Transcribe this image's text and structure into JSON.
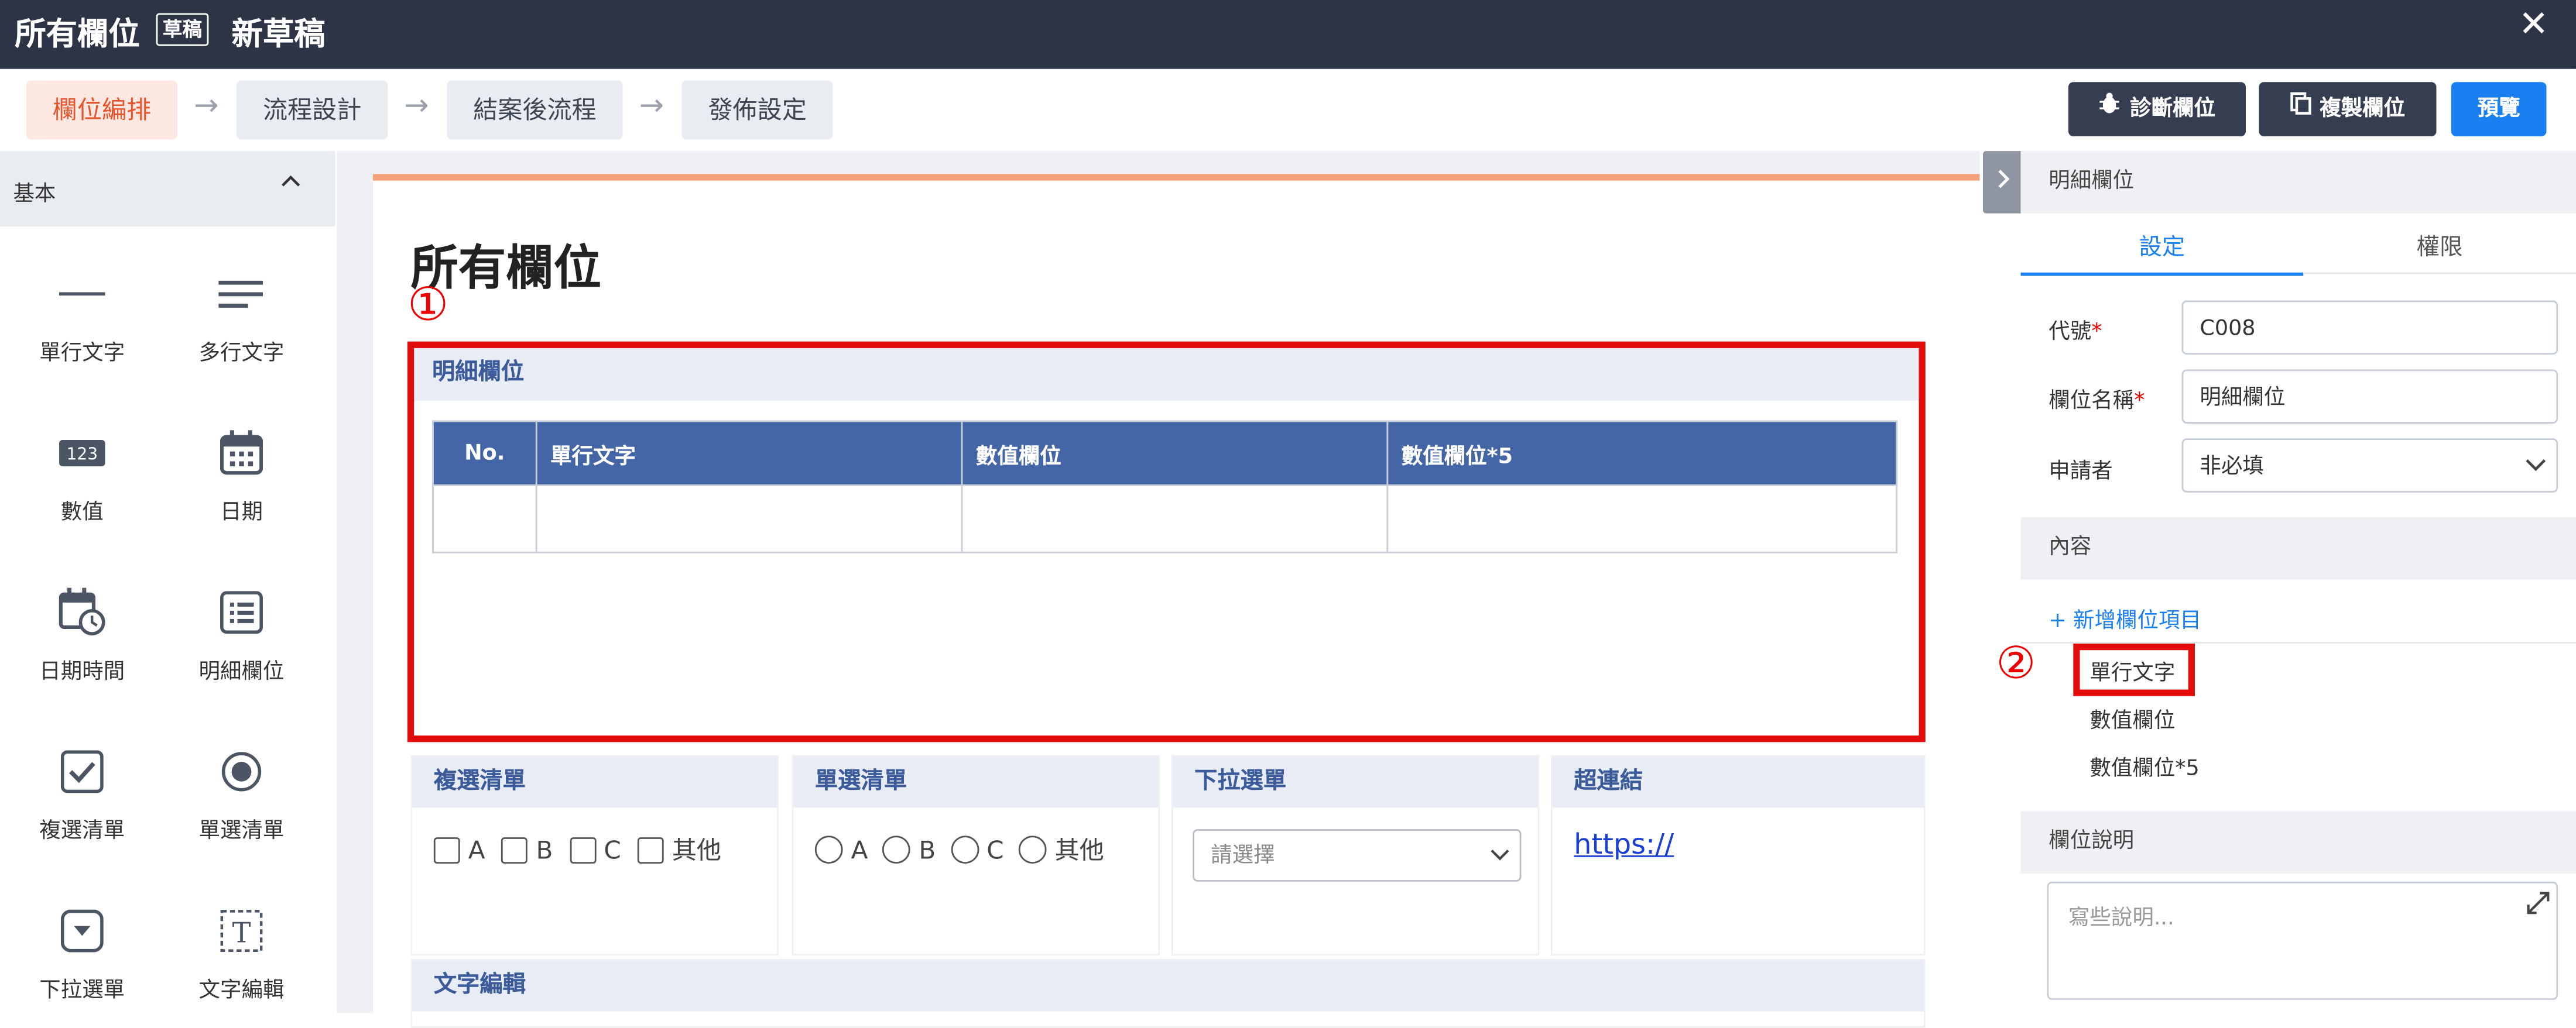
{
  "titlebar": {
    "title": "所有欄位",
    "badge": "草稿",
    "doc_name": "新草稿",
    "close": "✕"
  },
  "steps": [
    {
      "label": "欄位編排",
      "active": true
    },
    {
      "label": "流程設計",
      "active": false
    },
    {
      "label": "結案後流程",
      "active": false
    },
    {
      "label": "發佈設定",
      "active": false
    }
  ],
  "toolbar": {
    "diagnose": "診斷欄位",
    "copy": "複製欄位",
    "preview": "預覽"
  },
  "palette": {
    "category": "基本",
    "tools": [
      {
        "label": "單行文字",
        "icon": "single-line-text-icon"
      },
      {
        "label": "多行文字",
        "icon": "multi-line-text-icon"
      },
      {
        "label": "數值",
        "icon": "number-icon"
      },
      {
        "label": "日期",
        "icon": "calendar-icon"
      },
      {
        "label": "日期時間",
        "icon": "datetime-icon"
      },
      {
        "label": "明細欄位",
        "icon": "detail-list-icon"
      },
      {
        "label": "複選清單",
        "icon": "checkbox-icon"
      },
      {
        "label": "單選清單",
        "icon": "radio-icon"
      },
      {
        "label": "下拉選單",
        "icon": "dropdown-icon"
      },
      {
        "label": "文字編輯",
        "icon": "text-editor-icon"
      }
    ]
  },
  "canvas": {
    "form_title": "所有欄位",
    "marker1": "①",
    "detail": {
      "title": "明細欄位",
      "columns": [
        "No.",
        "單行文字",
        "數值欄位",
        "數值欄位*5"
      ]
    },
    "checkbox_field": {
      "title": "複選清單",
      "options": [
        "A",
        "B",
        "C",
        "其他"
      ]
    },
    "radio_field": {
      "title": "單選清單",
      "options": [
        "A",
        "B",
        "C",
        "其他"
      ]
    },
    "dropdown_field": {
      "title": "下拉選單",
      "placeholder": "請選擇"
    },
    "link_field": {
      "title": "超連結",
      "value": "https://"
    },
    "text_editor_field": {
      "title": "文字編輯"
    }
  },
  "right_panel": {
    "header": "明細欄位",
    "tabs": [
      {
        "label": "設定",
        "active": true
      },
      {
        "label": "權限",
        "active": false
      }
    ],
    "code_label": "代號",
    "code_value": "C008",
    "name_label": "欄位名稱",
    "name_value": "明細欄位",
    "applicant_label": "申請者",
    "applicant_value": "非必填",
    "content_header": "內容",
    "add_item": "新增欄位項目",
    "marker2": "②",
    "items": [
      "單行文字",
      "數值欄位",
      "數值欄位*5"
    ],
    "desc_header": "欄位說明",
    "desc_placeholder": "寫些說明..."
  },
  "colors": {
    "accent": "#e8542c",
    "primary": "#1a7ff0",
    "titlebar": "#2c3446",
    "table_header": "#4466a6",
    "highlight": "#e40b0b"
  }
}
